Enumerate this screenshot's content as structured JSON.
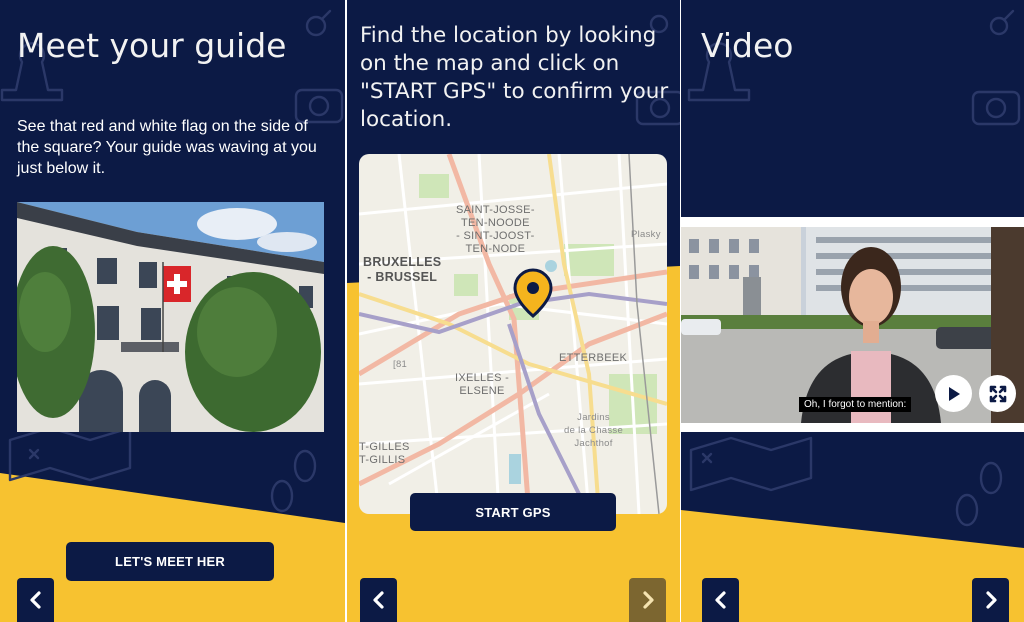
{
  "panels": {
    "guide": {
      "title": "Meet your guide",
      "body": "See that red and white flag on the side of the square? Your guide was waving at you just below it.",
      "button_label": "LET'S MEET HER",
      "prev_icon": "chevron-left-icon"
    },
    "location": {
      "title": "Find the location by looking on the map and click on \"START GPS\" to confirm your location.",
      "button_label": "START GPS",
      "map_labels": {
        "saint_josse": "SAINT-JOSSE-\nTEN-NOODE\n- SINT-JOOST-\nTEN-NODE",
        "bruxelles": "BRUXELLES\n- BRUSSEL",
        "plasky": "Plasky",
        "etterbeek": "ETTERBEEK",
        "ixelles": "IXELLES -\nELSENE",
        "gilles": "T-GILLES\nT-GILLIS",
        "jardins": "Jardins\nde la Chasse\nJachthof",
        "road_81": "[81"
      },
      "prev_icon": "chevron-left-icon",
      "next_icon": "chevron-right-icon"
    },
    "video": {
      "title": "Video",
      "caption": "Oh, I forgot to mention:",
      "prev_icon": "chevron-left-icon",
      "next_icon": "chevron-right-icon"
    }
  },
  "colors": {
    "navy": "#0c1a45",
    "yellow": "#f7c230",
    "marker": "#f5b41d"
  }
}
